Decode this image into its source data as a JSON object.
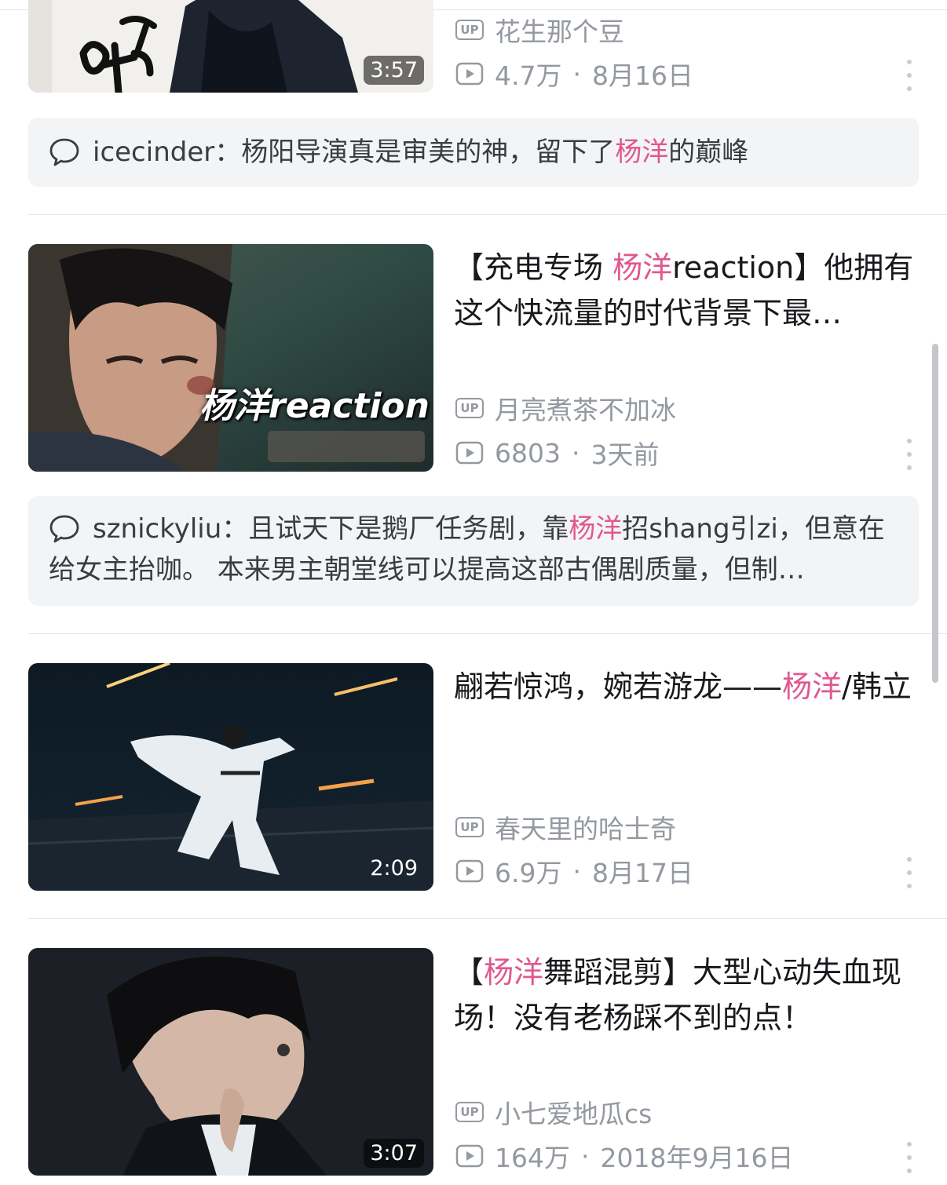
{
  "items": [
    {
      "duration": "3:57",
      "uploader": "花生那个豆",
      "views": "4.7万",
      "date": "8月16日",
      "comment": {
        "user": "icecinder",
        "colon": "：",
        "before": "杨阳导演真是审美的神，留下了",
        "highlight": "杨洋",
        "after": "的巅峰"
      }
    },
    {
      "title_before": "【充电专场 ",
      "title_highlight": "杨洋",
      "title_after": "reaction】他拥有这个快流量的时代背景下最…",
      "thumb_caption": "杨洋reaction",
      "uploader": "月亮煮茶不加冰",
      "views": "6803",
      "date": "3天前",
      "comment": {
        "user": "sznickyliu",
        "colon": "：",
        "before": "且试天下是鹅厂任务剧，靠",
        "highlight": "杨洋",
        "after": "招shang引zi，但意在给女主抬咖。 本来男主朝堂线可以提高这部古偶剧质量，但制…"
      }
    },
    {
      "title_before": "翩若惊鸿，婉若游龙——",
      "title_highlight": "杨洋",
      "title_after": "/韩立",
      "duration": "2:09",
      "uploader": "春天里的哈士奇",
      "views": "6.9万",
      "date": "8月17日"
    },
    {
      "title_before": "【",
      "title_highlight": "杨洋",
      "title_after": "舞蹈混剪】大型心动失血现场！没有老杨踩不到的点！",
      "duration": "3:07",
      "uploader": "小七爱地瓜cs",
      "views": "164万",
      "date": "2018年9月16日"
    }
  ],
  "labels": {
    "up_badge": "UP",
    "separator": "·"
  },
  "colors": {
    "highlight": "#e0588e",
    "meta": "#9499a0",
    "comment_bg": "#f3f4f6"
  },
  "icons": [
    "up-badge-icon",
    "play-count-icon",
    "more-options-icon",
    "comment-bubble-icon"
  ]
}
